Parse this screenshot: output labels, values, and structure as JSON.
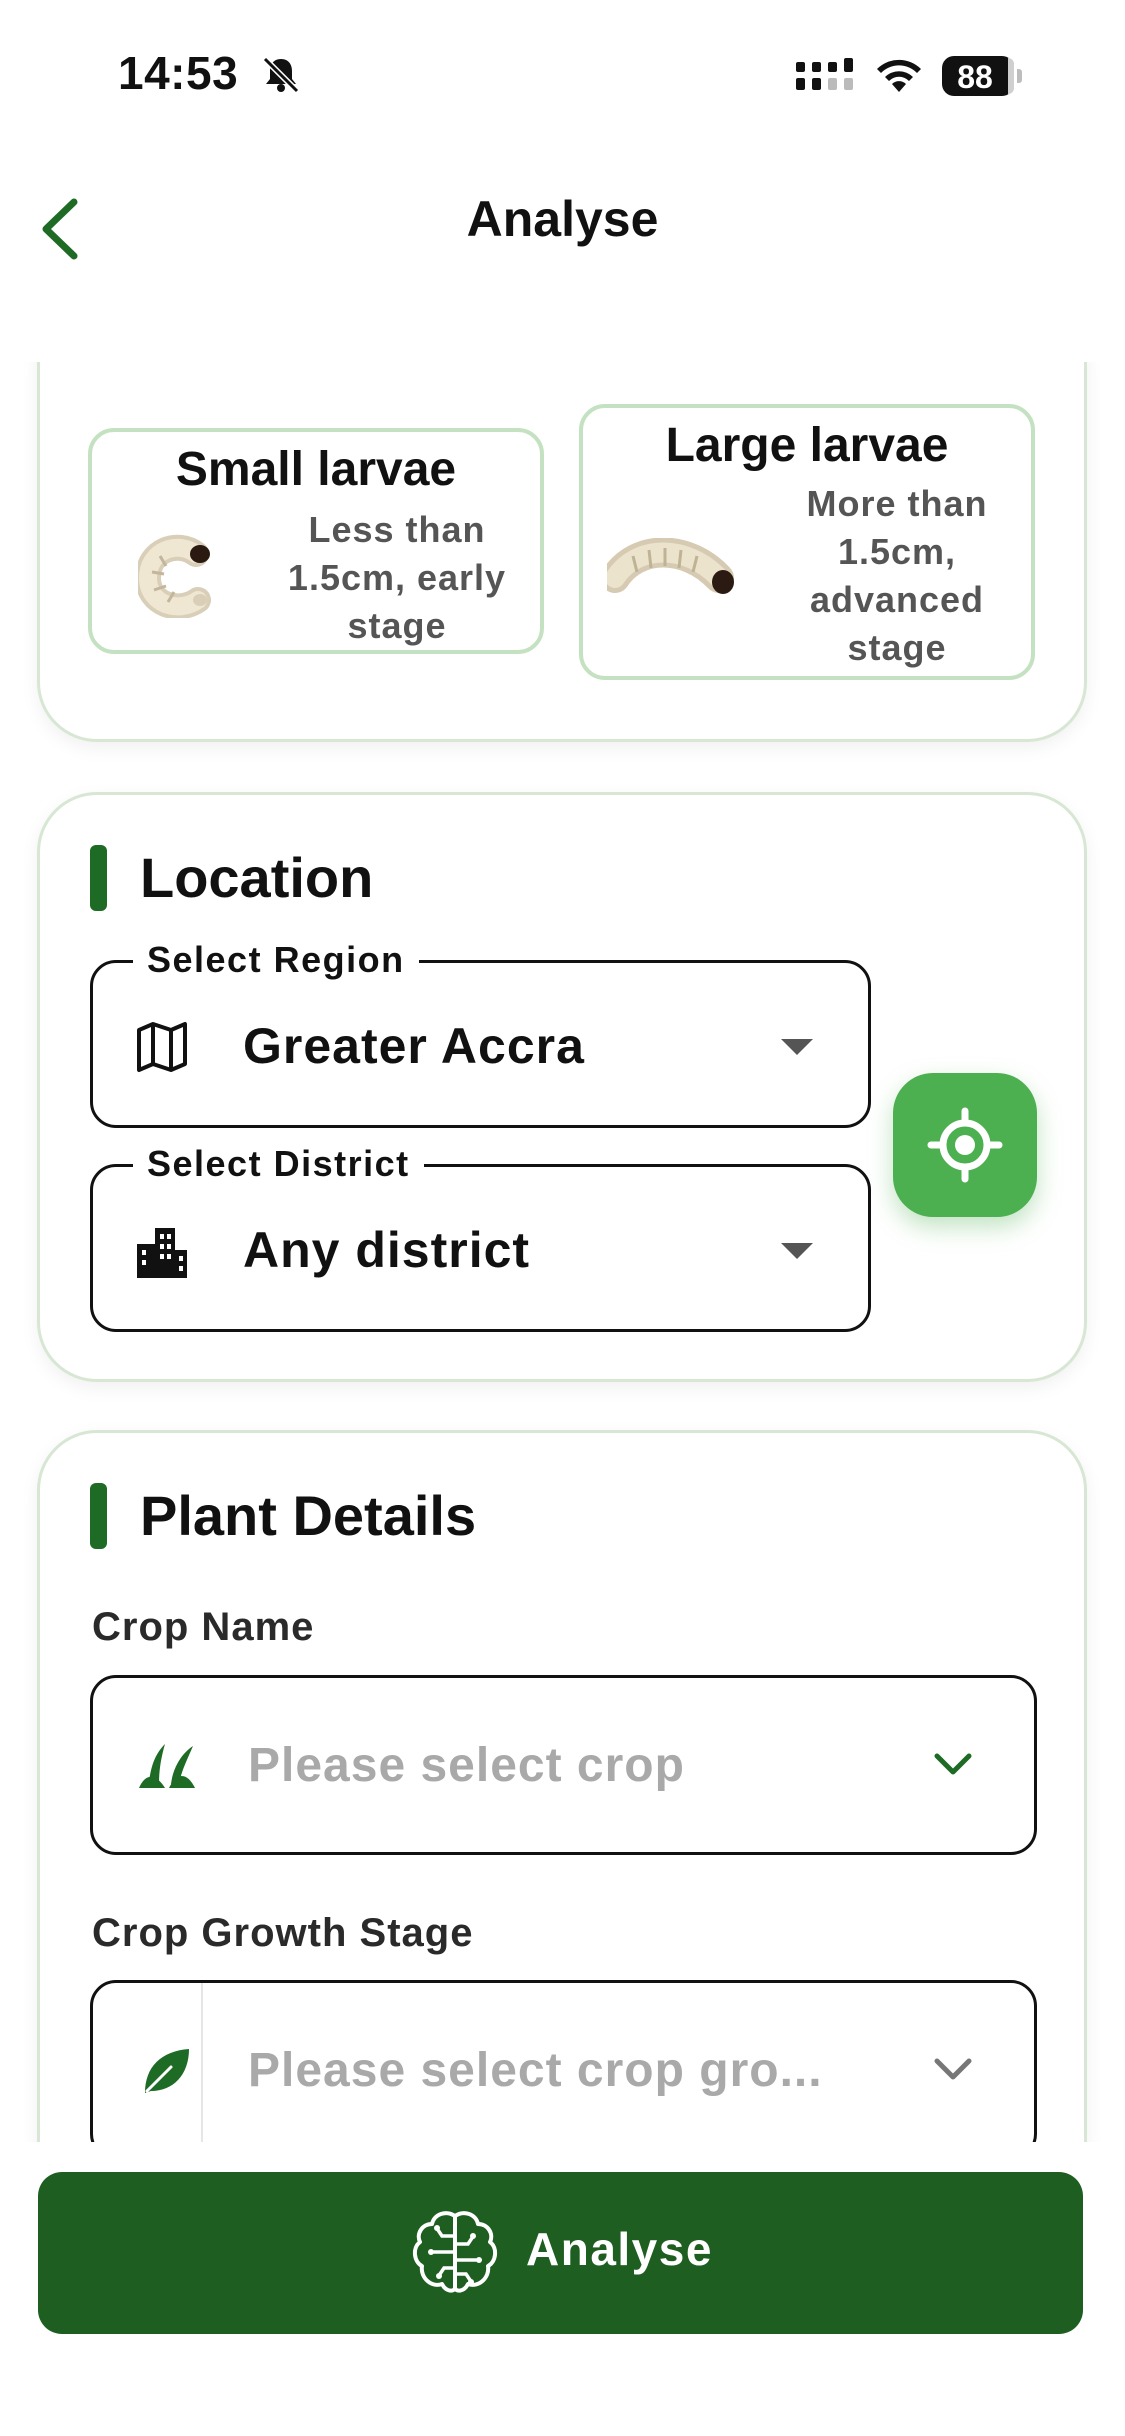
{
  "status_bar": {
    "time": "14:53",
    "battery": "88"
  },
  "nav": {
    "title": "Analyse"
  },
  "larvae": {
    "small": {
      "title": "Small larvae",
      "description": "Less than 1.5cm, early stage"
    },
    "large": {
      "title": "Large larvae",
      "description": "More than 1.5cm, advanced stage"
    }
  },
  "location": {
    "title": "Location",
    "region": {
      "label": "Select Region",
      "value": "Greater Accra"
    },
    "district": {
      "label": "Select District",
      "value": "Any district"
    }
  },
  "plant_details": {
    "title": "Plant Details",
    "crop_name": {
      "label": "Crop Name",
      "placeholder": "Please select crop"
    },
    "growth_stage": {
      "label": "Crop Growth Stage",
      "placeholder": "Please select crop gro..."
    }
  },
  "footer": {
    "analyse_label": "Analyse"
  },
  "colors": {
    "primary": "#1e5e20",
    "accent": "#4caf50",
    "card_border": "#d7e7d4"
  }
}
